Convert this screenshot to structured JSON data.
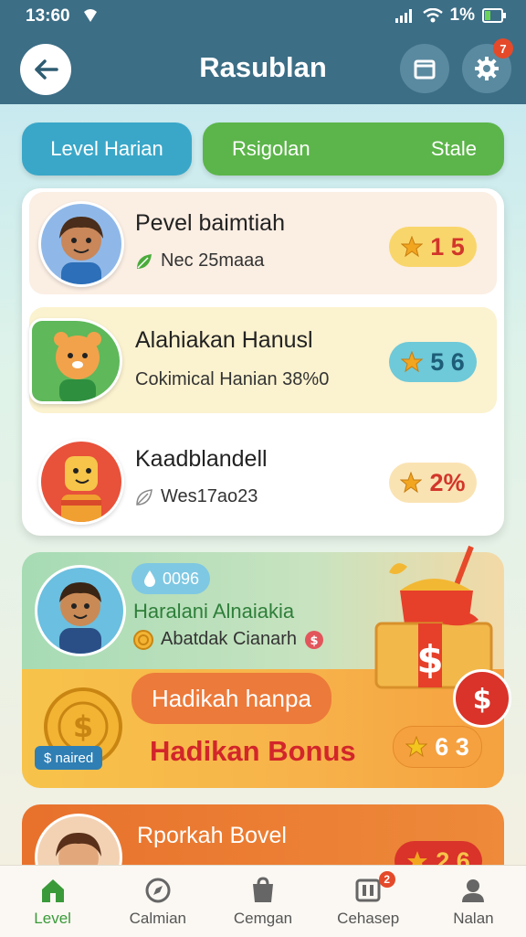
{
  "status": {
    "time": "13:60",
    "battery": "1%"
  },
  "header": {
    "title": "Rasublan",
    "settings_badge": "7"
  },
  "tabs": {
    "left": "Level Harian",
    "middle": "Rsigolan",
    "right": "Stale"
  },
  "list": [
    {
      "name": "Pevel baimtiah",
      "sub": "Nec 25maaa",
      "score": "1 5"
    },
    {
      "name": "Alahiakan Hanusl",
      "sub": "Cokimical Hanian 38%0",
      "score": "5 6"
    },
    {
      "name": "Kaadblandell",
      "sub": "Wes17ao23",
      "score": "2%"
    }
  ],
  "bonus": {
    "drop_badge": "0096",
    "name": "Haralani Alnaiakia",
    "sub": "Abatdak Cianarh",
    "coin_label": "$ naired",
    "pill_text": "Hadikah hanpa",
    "headline": "Hadikan Bonus",
    "score": "6 3"
  },
  "partial": {
    "name": "Rporkah Bovel",
    "score": "2 6"
  },
  "nav": [
    {
      "label": "Level",
      "icon": "home-icon"
    },
    {
      "label": "Calmian",
      "icon": "compass-icon"
    },
    {
      "label": "Cemgan",
      "icon": "shop-icon"
    },
    {
      "label": "Cehasep",
      "icon": "cards-icon",
      "badge": "2"
    },
    {
      "label": "Nalan",
      "icon": "person-icon"
    }
  ],
  "colors": {
    "header": "#3c6e86",
    "accent_green": "#5cb54a",
    "accent_blue": "#3aa7c8",
    "accent_red": "#d9332a"
  }
}
